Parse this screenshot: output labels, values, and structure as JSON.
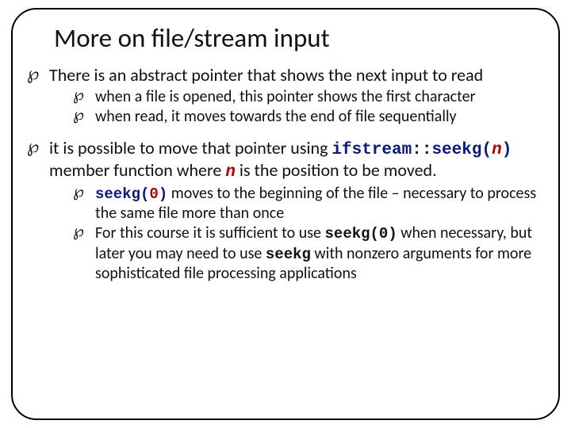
{
  "title": "More on file/stream input",
  "b1": "There is an abstract pointer that shows the next input to read",
  "b1s1": "when a file is opened, this pointer shows the first character",
  "b1s2": "when read, it moves towards the end of file sequentially",
  "b2a": "it is possible to move that pointer using ",
  "b2_code_ifstream": "ifstream",
  "b2_code_colons": "::",
  "b2_code_seekg": "seekg(",
  "b2_code_n": "n",
  "b2_code_close": ")",
  "b2b": " member function where ",
  "b2_code_n2": "n",
  "b2c": " is the position to be moved.",
  "b2s1_code": "seekg(",
  "b2s1_code_arg": "0",
  "b2s1_code_close": ")",
  "b2s1a": " moves to the beginning of the file – necessary to process the same file more than once",
  "b2s2a": "For this course it is sufficient to use ",
  "b2s2_code1": "seekg(0)",
  "b2s2b": " when necessary, but later you may need to use ",
  "b2s2_code2": "seekg",
  "b2s2c": " with nonzero arguments for more sophisticated file processing applications"
}
